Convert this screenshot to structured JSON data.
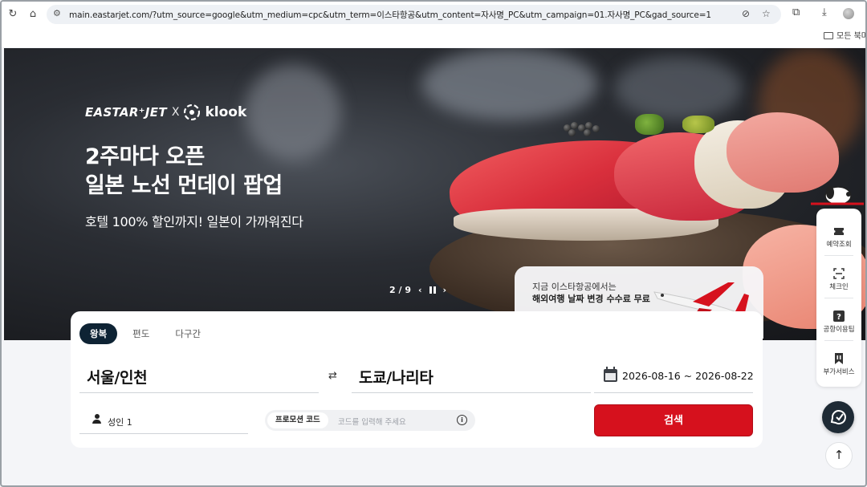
{
  "browser": {
    "url": "main.eastarjet.com/?utm_source=google&utm_medium=cpc&utm_term=이스타항공&utm_content=자사명_PC&utm_campaign=01.자사명_PC&gad_source=1",
    "bookmarks_label": "모든 북마"
  },
  "hero": {
    "brand_eastar": "EASTAR⁺JET",
    "brand_x": "X",
    "brand_klook": "klook",
    "title_line1": "2주마다 오픈",
    "title_line2": "일본 노선 먼데이 팝업",
    "subtitle": "호텔 100% 할인까지! 일본이 가까워진다",
    "pager": "2 / 9",
    "promo_line1": "지금 이스타항공에서는",
    "promo_line2": "해외여행 날짜 변경 수수료 무료"
  },
  "search": {
    "tabs": [
      {
        "label": "왕복",
        "active": true
      },
      {
        "label": "편도",
        "active": false
      },
      {
        "label": "다구간",
        "active": false
      }
    ],
    "origin": "서울/인천",
    "destination": "도쿄/나리타",
    "swap_symbol": "⇄",
    "dates": "2026-08-16 ~ 2026-08-22",
    "passengers": "성인 1",
    "promo_chip": "프로모션 코드",
    "promo_placeholder": "코드를 입력해 주세요",
    "search_button": "검색"
  },
  "quick_menu": {
    "items": [
      {
        "label": "예약조회",
        "icon": "ticket-icon"
      },
      {
        "label": "체크인",
        "icon": "scan-icon"
      },
      {
        "label": "공항이용팁",
        "icon": "question-icon"
      },
      {
        "label": "부가서비스",
        "icon": "bookmark-icon"
      }
    ]
  },
  "colors": {
    "brand_red": "#d6111d",
    "navy": "#0e2334"
  }
}
